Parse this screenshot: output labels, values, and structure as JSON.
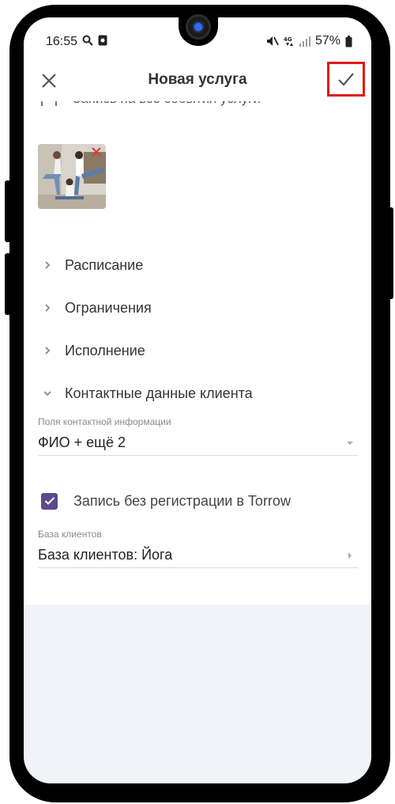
{
  "status_bar": {
    "time": "16:55",
    "network": "4G",
    "battery": "57%"
  },
  "app_bar": {
    "title": "Новая услуга",
    "close_icon": "close-icon",
    "save_icon": "checkmark-icon",
    "save_highlight_color": "#e41818"
  },
  "partial_row": {
    "label": "Запись на все события услуги"
  },
  "image": {
    "delete_icon": "close-icon",
    "delete_color": "#e53935"
  },
  "sections": [
    {
      "label": "Расписание",
      "expanded": false
    },
    {
      "label": "Ограничения",
      "expanded": false
    },
    {
      "label": "Исполнение",
      "expanded": false
    },
    {
      "label": "Контактные данные клиента",
      "expanded": true
    }
  ],
  "contact_fields": {
    "caption": "Поля контактной информации",
    "value": "ФИО + ещё 2"
  },
  "registration": {
    "label": "Запись без регистрации в Torrow",
    "checked": true,
    "checkbox_color": "#5b4a8c"
  },
  "client_base": {
    "caption": "База клиентов",
    "value": "База клиентов: Йога"
  }
}
